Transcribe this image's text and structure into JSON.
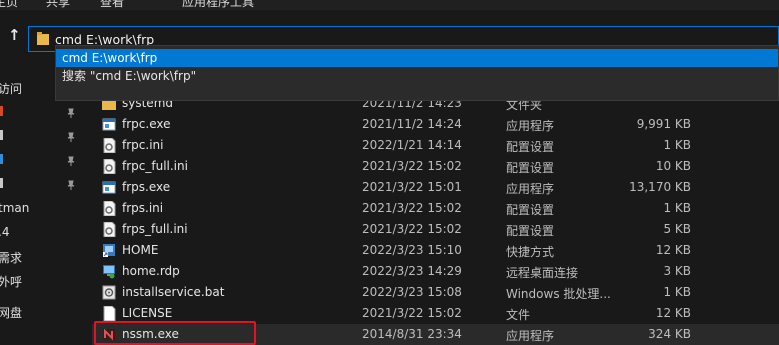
{
  "ribbon": {
    "tabs": [
      "主页",
      "共享",
      "查看",
      "应用程序工具"
    ]
  },
  "address": {
    "value": "cmd E:\\work\\frp",
    "suggestions": [
      {
        "label": "cmd E:\\work\\frp",
        "selected": true
      },
      {
        "label": "搜索 \"cmd E:\\work\\frp\"",
        "selected": false
      }
    ]
  },
  "nav": {
    "items": [
      "访问",
      "",
      "",
      "",
      "",
      "tman",
      ".4",
      "需求",
      "外呼",
      "网盘"
    ]
  },
  "files": [
    {
      "name": "systemd",
      "date": "2021/11/2 14:23",
      "type": "文件夹",
      "size": "",
      "icon": "folder-icon"
    },
    {
      "name": "frpc.exe",
      "date": "2021/11/2 14:24",
      "type": "应用程序",
      "size": "9,991 KB",
      "icon": "exe-icon"
    },
    {
      "name": "frpc.ini",
      "date": "2022/1/21 14:14",
      "type": "配置设置",
      "size": "1 KB",
      "icon": "ini-icon"
    },
    {
      "name": "frpc_full.ini",
      "date": "2021/3/22 15:02",
      "type": "配置设置",
      "size": "10 KB",
      "icon": "ini-icon"
    },
    {
      "name": "frps.exe",
      "date": "2021/3/22 15:01",
      "type": "应用程序",
      "size": "13,170 KB",
      "icon": "exe-icon"
    },
    {
      "name": "frps.ini",
      "date": "2021/3/22 15:02",
      "type": "配置设置",
      "size": "1 KB",
      "icon": "ini-icon"
    },
    {
      "name": "frps_full.ini",
      "date": "2021/3/22 15:02",
      "type": "配置设置",
      "size": "5 KB",
      "icon": "ini-icon"
    },
    {
      "name": "HOME",
      "date": "2022/3/23 15:10",
      "type": "快捷方式",
      "size": "12 KB",
      "icon": "shortcut-icon"
    },
    {
      "name": "home.rdp",
      "date": "2022/3/23 14:29",
      "type": "远程桌面连接",
      "size": "3 KB",
      "icon": "rdp-icon"
    },
    {
      "name": "installservice.bat",
      "date": "2022/3/23 15:08",
      "type": "Windows 批处理...",
      "size": "1 KB",
      "icon": "bat-icon"
    },
    {
      "name": "LICENSE",
      "date": "2021/3/22 15:02",
      "type": "文件",
      "size": "12 KB",
      "icon": "file-icon"
    },
    {
      "name": "nssm.exe",
      "date": "2014/8/31 23:34",
      "type": "应用程序",
      "size": "324 KB",
      "icon": "nssm-icon"
    }
  ]
}
